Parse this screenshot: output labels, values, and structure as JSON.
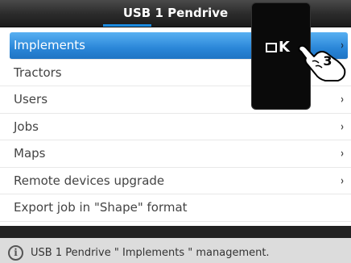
{
  "header": {
    "title": "USB 1 Pendrive"
  },
  "menu": {
    "items": [
      {
        "label": "Implements",
        "has_submenu": true,
        "selected": true
      },
      {
        "label": "Tractors",
        "has_submenu": false,
        "selected": false
      },
      {
        "label": "Users",
        "has_submenu": true,
        "selected": false
      },
      {
        "label": "Jobs",
        "has_submenu": true,
        "selected": false
      },
      {
        "label": "Maps",
        "has_submenu": true,
        "selected": false
      },
      {
        "label": "Remote devices upgrade",
        "has_submenu": true,
        "selected": false
      },
      {
        "label": "Export job in \"Shape\" format",
        "has_submenu": false,
        "selected": false
      }
    ],
    "chevron": "›"
  },
  "status": {
    "icon": "info-icon",
    "text": "USB 1 Pendrive \" Implements \" management."
  },
  "overlay": {
    "key_label": "K",
    "step_number": "3",
    "key_icon": "ok-key-icon",
    "hand_icon": "pointing-hand-icon"
  },
  "colors": {
    "selected": "#2a86d8",
    "header": "#2a2a2a",
    "accent": "#1b8be0",
    "status_bar": "#dcdcdc"
  }
}
